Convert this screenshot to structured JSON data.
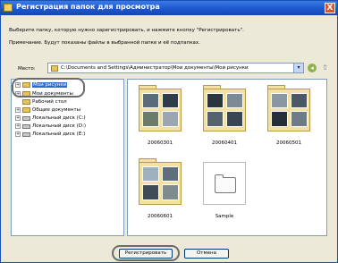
{
  "window": {
    "title": "Регистрация папок для просмотра",
    "close_label": "X"
  },
  "instruction": "Выберите папку, которую нужно зарегистрировать, и нажмите кнопку \"Регистрировать\".",
  "note": "Примечание. Будут показаны файлы в выбранной папке и её подпапках.",
  "location": {
    "label": "Место:",
    "path": "C:\\Documents and Settings\\Администратор\\Мои документы\\Мои рисунки"
  },
  "tree": {
    "items": [
      {
        "label": "Мои рисунки",
        "expander": "+"
      },
      {
        "label": "Мои документы",
        "expander": "+"
      },
      {
        "label": "Рабочий стол",
        "expander": ""
      },
      {
        "label": "Общие документы",
        "expander": "+"
      },
      {
        "label": "Локальный диск (C:)",
        "expander": "+"
      },
      {
        "label": "Локальный диск (D:)",
        "expander": "+"
      },
      {
        "label": "Локальный диск (E:)",
        "expander": "+"
      }
    ]
  },
  "folders": [
    {
      "label": "20060301"
    },
    {
      "label": "20060401"
    },
    {
      "label": "20060501"
    },
    {
      "label": "20060601"
    },
    {
      "label": "Sample"
    }
  ],
  "buttons": {
    "register": "Регистрировать",
    "cancel": "Отмена"
  },
  "icons": {
    "title": "folder-icon",
    "back": "back-arrow-icon",
    "up": "folder-up-icon"
  },
  "colors": {
    "titlebar": "#1c55cc",
    "selection": "#316ac5",
    "highlight": "#6a6a6a"
  }
}
